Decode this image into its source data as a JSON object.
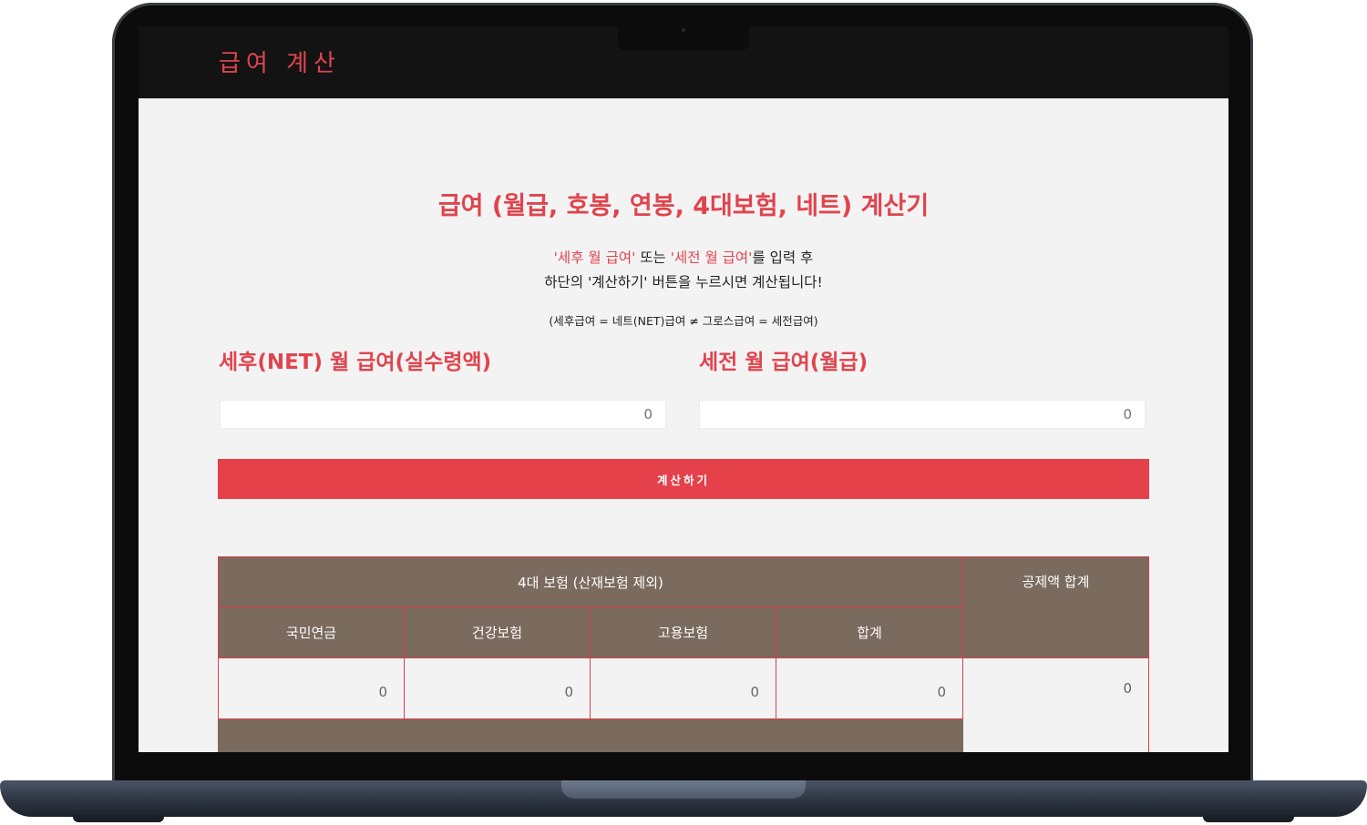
{
  "header": {
    "app_title": "급여 계산"
  },
  "main": {
    "title": "급여 (월급, 호봉, 연봉, 4대보험, 네트) 계산기",
    "instructions": {
      "line1": [
        "'세후 월 급여'",
        " 또는 ",
        "'세전 월 급여'",
        "를 입력 후"
      ],
      "line2": "하단의 '계산하기' 버튼을 누르시면 계산됩니다!"
    },
    "formula": "(세후급여 = 네트(NET)급여 ≠ 그로스급여 = 세전급여)",
    "net_label": "세후(NET) 월 급여(실수령액)",
    "gross_label": "세전 월 급여(월급)",
    "net_placeholder": "0",
    "gross_placeholder": "0",
    "calc_button": "계산하기"
  },
  "table": {
    "group_header": "4대 보험 (산재보험 제외)",
    "total_header": "공제액 합계",
    "columns": [
      "국민연금",
      "건강보험",
      "고용보험",
      "합계"
    ],
    "values": [
      "0",
      "0",
      "0",
      "0",
      "0"
    ]
  },
  "colors": {
    "accent": "#e0444d",
    "table_header": "#7b6a5e",
    "page_bg": "#f4f3f4"
  }
}
